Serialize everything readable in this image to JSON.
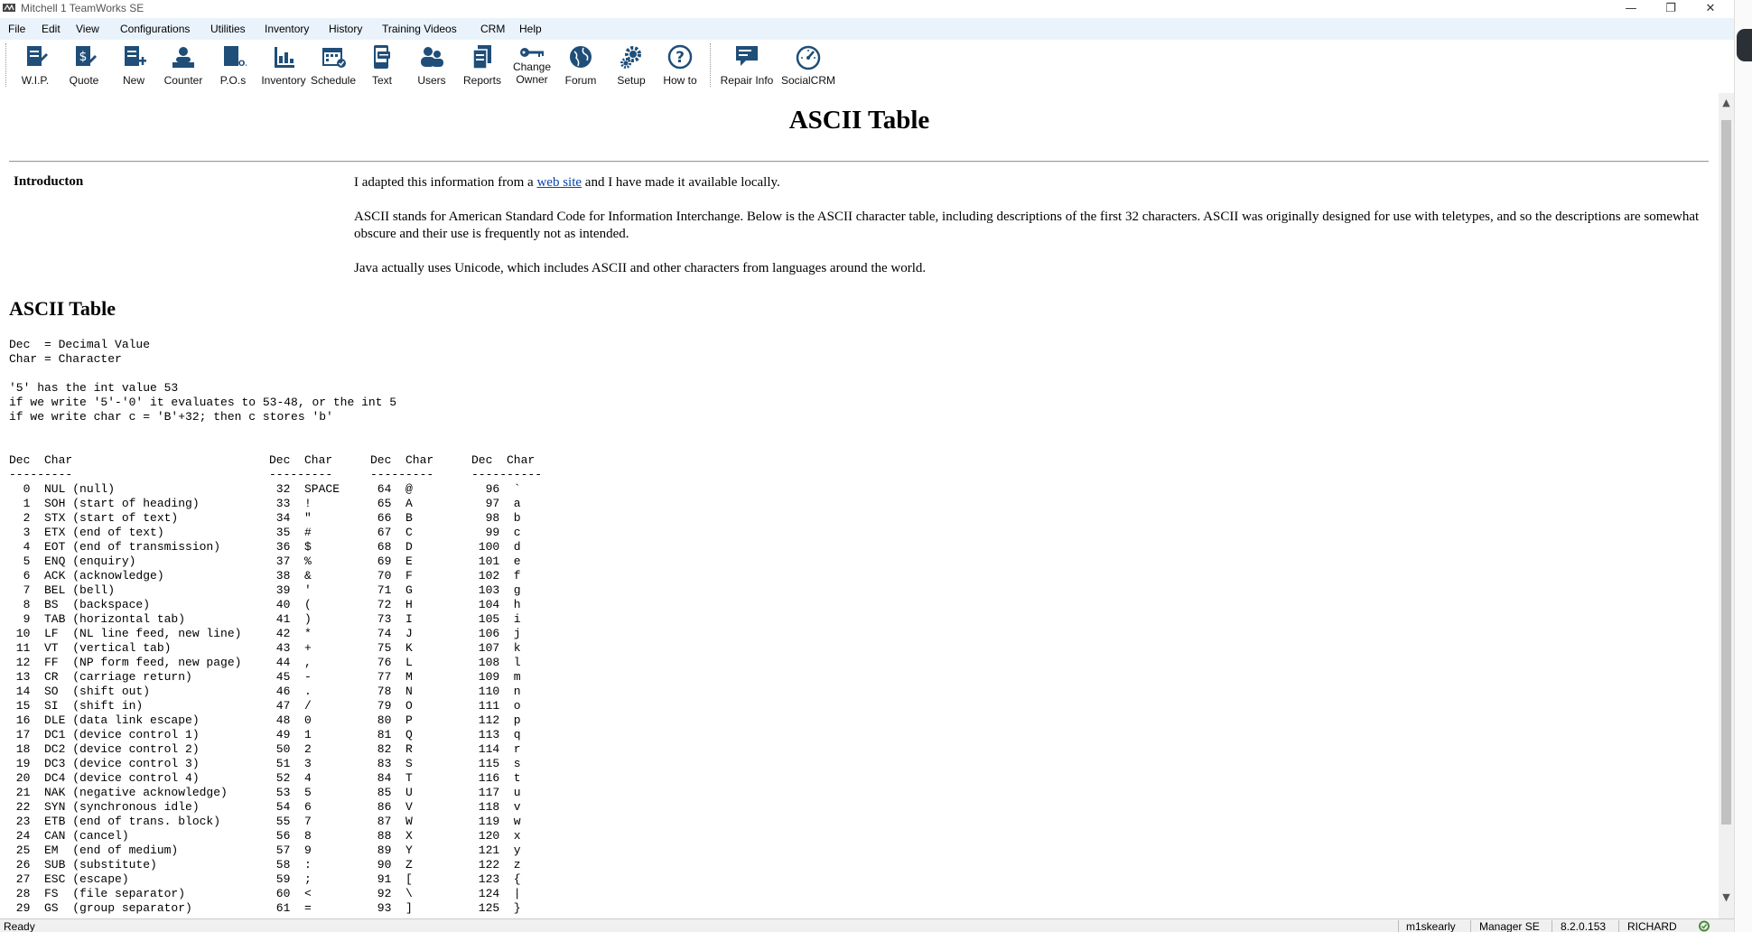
{
  "window": {
    "title": "Mitchell 1 TeamWorks SE",
    "controls": [
      "—",
      "❐",
      "✕"
    ]
  },
  "menu": [
    "File",
    "Edit",
    "View",
    "Configurations",
    "Utilities",
    "Inventory",
    "History",
    "Training Videos",
    "CRM",
    "Help"
  ],
  "toolbar": [
    {
      "label": "W.I.P.",
      "icon": "wip-icon"
    },
    {
      "label": "Quote",
      "icon": "quote-icon"
    },
    {
      "label": "New",
      "icon": "new-icon"
    },
    {
      "label": "Counter",
      "icon": "counter-icon"
    },
    {
      "label": "P.O.s",
      "icon": "po-icon"
    },
    {
      "label": "Inventory",
      "icon": "inventory-icon"
    },
    {
      "label": "Schedule",
      "icon": "schedule-icon"
    },
    {
      "label": "Text",
      "icon": "text-icon"
    },
    {
      "label": "Users",
      "icon": "users-icon"
    },
    {
      "label": "Reports",
      "icon": "reports-icon"
    },
    {
      "label": "Change\nOwner",
      "icon": "key-icon"
    },
    {
      "label": "Forum",
      "icon": "globe-icon"
    },
    {
      "label": "Setup",
      "icon": "gear-icon"
    },
    {
      "label": "How to",
      "icon": "question-icon"
    },
    {
      "label": "Repair Info",
      "icon": "repair-info-icon"
    },
    {
      "label": "SocialCRM",
      "icon": "gauge-icon"
    }
  ],
  "doc": {
    "title": "ASCII Table",
    "intro_label": "Introducton",
    "intro_p1_before": "I adapted this information from a ",
    "intro_p1_link": "web site",
    "intro_p1_after": " and I have made it available locally.",
    "intro_p2": "ASCII stands for American Standard Code for Information Interchange. Below is the ASCII character table, including descriptions of the first 32 characters. ASCII was originally designed for use with teletypes, and so the descriptions are somewhat obscure and their use is frequently not as intended.",
    "intro_p3": "Java actually uses Unicode, which includes ASCII and other characters from languages around the world.",
    "subtitle": "ASCII Table",
    "legend": "Dec  = Decimal Value\nChar = Character",
    "notes": "'5' has the int value 53\nif we write '5'-'0' it evaluates to 53-48, or the int 5\nif we write char c = 'B'+32; then c stores 'b'",
    "table": {
      "col1": "Dec  Char\n---------\n  0  NUL (null)\n  1  SOH (start of heading)\n  2  STX (start of text)\n  3  ETX (end of text)\n  4  EOT (end of transmission)\n  5  ENQ (enquiry)\n  6  ACK (acknowledge)\n  7  BEL (bell)\n  8  BS  (backspace)\n  9  TAB (horizontal tab)\n 10  LF  (NL line feed, new line)\n 11  VT  (vertical tab)\n 12  FF  (NP form feed, new page)\n 13  CR  (carriage return)\n 14  SO  (shift out)\n 15  SI  (shift in)\n 16  DLE (data link escape)\n 17  DC1 (device control 1)\n 18  DC2 (device control 2)\n 19  DC3 (device control 3)\n 20  DC4 (device control 4)\n 21  NAK (negative acknowledge)\n 22  SYN (synchronous idle)\n 23  ETB (end of trans. block)\n 24  CAN (cancel)\n 25  EM  (end of medium)\n 26  SUB (substitute)\n 27  ESC (escape)\n 28  FS  (file separator)\n 29  GS  (group separator)",
      "col2": "Dec  Char\n---------\n 32  SPACE\n 33  !\n 34  \"\n 35  #\n 36  $\n 37  %\n 38  &\n 39  '\n 40  (\n 41  )\n 42  *\n 43  +\n 44  ,\n 45  -\n 46  .\n 47  /\n 48  0\n 49  1\n 50  2\n 51  3\n 52  4\n 53  5\n 54  6\n 55  7\n 56  8\n 57  9\n 58  :\n 59  ;\n 60  <\n 61  =",
      "col3": "Dec  Char\n---------\n 64  @\n 65  A\n 66  B\n 67  C\n 68  D\n 69  E\n 70  F\n 71  G\n 72  H\n 73  I\n 74  J\n 75  K\n 76  L\n 77  M\n 78  N\n 79  O\n 80  P\n 81  Q\n 82  R\n 83  S\n 84  T\n 85  U\n 86  V\n 87  W\n 88  X\n 89  Y\n 90  Z\n 91  [\n 92  \\\n 93  ]",
      "col4": "Dec  Char\n----------\n  96  `\n  97  a\n  98  b\n  99  c\n 100  d\n 101  e\n 102  f\n 103  g\n 104  h\n 105  i\n 106  j\n 107  k\n 108  l\n 109  m\n 110  n\n 111  o\n 112  p\n 113  q\n 114  r\n 115  s\n 116  t\n 117  u\n 118  v\n 119  w\n 120  x\n 121  y\n 122  z\n 123  {\n 124  |\n 125  }"
    }
  },
  "status": {
    "left": "Ready",
    "user": "m1skearly",
    "product": "Manager SE",
    "version": "8.2.0.153",
    "name": "RICHARD"
  },
  "colors": {
    "icon": "#1f4e79",
    "menu_bg": "#eaf3fb",
    "link": "#0645ad"
  }
}
